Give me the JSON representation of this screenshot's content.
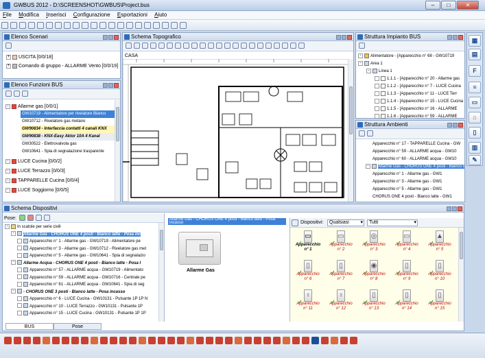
{
  "window": {
    "title": "GWBUS 2012 - D:\\SCREENSHOT\\GWBUS\\Project.bus",
    "min": "–",
    "max": "□",
    "close": "✕"
  },
  "menu": [
    {
      "accel": "F",
      "rest": "ile"
    },
    {
      "accel": "M",
      "rest": "odifica"
    },
    {
      "accel": "I",
      "rest": "nserisci"
    },
    {
      "accel": "C",
      "rest": "onfigurazione"
    },
    {
      "accel": "E",
      "rest": "sportazioni"
    },
    {
      "accel": "A",
      "rest": "iuto"
    }
  ],
  "scenari": {
    "title": "Elenco Scenari",
    "items": [
      {
        "label": "USCITA [0/0/18]"
      },
      {
        "label": "Comando di gruppo - ALLARME Vento [0/0/19]"
      }
    ]
  },
  "funzioni": {
    "title": "Elenco Funzioni BUS",
    "items": [
      {
        "label": "Allarme gas [0/0/1]",
        "kind": "group"
      },
      {
        "label": "GW10719 - Alimentatore per rivelatore Bianco",
        "kind": "sel"
      },
      {
        "label": "GW10712 - Rivelatore gas metano",
        "kind": "plain"
      },
      {
        "label": "GW90834 - Interfaccia contatti 4 canali KNX",
        "kind": "yel"
      },
      {
        "label": "GW90838 - KNX-Easy Aktor 10A 4 Kanal",
        "kind": "gry"
      },
      {
        "label": "GW30522 - Elettrovalvola gas",
        "kind": "plain"
      },
      {
        "label": "GW10641 - Spia di segnalazione trasparente",
        "kind": "plain"
      },
      {
        "label": "LUCE Cucina [0/0/2]",
        "kind": "group"
      },
      {
        "label": "LUCE Terrazzo [0/0/3]",
        "kind": "group"
      },
      {
        "label": "TAPPARELLE Cucina [0/0/4]",
        "kind": "group"
      },
      {
        "label": "LUCE Soggiorno [0/0/5]",
        "kind": "group"
      }
    ]
  },
  "topo": {
    "title": "Schema Topografico",
    "floor": "CASA"
  },
  "impianto": {
    "title": "Struttura Impianto BUS",
    "items": [
      {
        "label": "Alimentatore - [Apparecchio n° 68 - GW10719",
        "lvl": 0
      },
      {
        "label": "Area 1",
        "lvl": 0
      },
      {
        "label": "Linea 1",
        "lvl": 1
      },
      {
        "label": "1.1.1 - [Apparecchio n° 20 - Allarme gas",
        "lvl": 2
      },
      {
        "label": "1.1.2 - [Apparecchio n° 7 - LUCE Cucina",
        "lvl": 2
      },
      {
        "label": "1.1.3 - [Apparecchio n° 11 - LUCE Terr",
        "lvl": 2
      },
      {
        "label": "1.1.4 - [Apparecchio n° 15 - LUCE Cucina",
        "lvl": 2
      },
      {
        "label": "1.1.5 - [Apparecchio n° 16 - ALLARME",
        "lvl": 2
      },
      {
        "label": "1.1.6 - [Apparecchio n° 59 - ALLARME",
        "lvl": 2
      }
    ]
  },
  "ambienti": {
    "title": "Struttura Ambienti",
    "items": [
      {
        "label": "Apparecchio n° 17 - TAPPARELLE Cucina - GW",
        "kind": "plain"
      },
      {
        "label": "Apparecchio n° 59 - ALLARME acqua - GW10",
        "kind": "plain"
      },
      {
        "label": "Apparecchio n° 60 - ALLARME acqua - GW10",
        "kind": "plain"
      },
      {
        "label": "Allarme Gas - CHORUS ONE 4 posti - Bianco latte - GW1",
        "kind": "sel"
      },
      {
        "label": "Apparecchio n° 1 - Allarme gas - GW1",
        "kind": "plain"
      },
      {
        "label": "Apparecchio n° 3 - Allarme gas - GW1",
        "kind": "plain"
      },
      {
        "label": "Apparecchio n° 5 - Allarme gas - GW1",
        "kind": "plain"
      },
      {
        "label": "CHORUS ONE 4 posti - Bianco latte - GW1",
        "kind": "plain"
      }
    ]
  },
  "dispositivi": {
    "title": "Schema Dispositivi"
  },
  "pose": {
    "label": "Pose:",
    "items": [
      {
        "label": "In scatole per serie civili",
        "kind": "plain",
        "lvl": 0
      },
      {
        "label": "Allarme Gas - CHORUS ONE 4 posti - Bianco latte - Posa inc",
        "kind": "sel",
        "lvl": 1
      },
      {
        "label": "Apparecchio n° 1 - Allarme gas - GW10719 - Alimentatore pe",
        "kind": "plain",
        "lvl": 2
      },
      {
        "label": "Apparecchio n° 3 - Allarme gas - GW10712 - Rivelatore gas met",
        "kind": "plain",
        "lvl": 2
      },
      {
        "label": "Apparecchio n° 5 - Allarme gas - GW10641 - Spia di segnalazio",
        "kind": "plain",
        "lvl": 2
      },
      {
        "label": "Allarme Acqua - CHORUS ONE 4 posti - Bianco latte - Posa I",
        "kind": "bi",
        "lvl": 1
      },
      {
        "label": "Apparecchio n° 57 - ALLARME acqua - GW10719 - Alimentato",
        "kind": "plain",
        "lvl": 2
      },
      {
        "label": "Apparecchio n° 59 - ALLARME acqua - GW10716 - Centrale pe",
        "kind": "plain",
        "lvl": 2
      },
      {
        "label": "Apparecchio n° 61 - ALLARME acqua - GW10641 - Spia di seg",
        "kind": "plain",
        "lvl": 2
      },
      {
        "label": "- CHORUS ONE 3 posti - Bianco latte - Posa incasso",
        "kind": "bi",
        "lvl": 1
      },
      {
        "label": "Apparecchio n° 6 - LUCE Cucina - GW10131 - Pulsante 1P 1P N",
        "kind": "plain",
        "lvl": 2
      },
      {
        "label": "Apparecchio n° 10 - LUCE Terrazzo - GW10131 - Pulsante 1P",
        "kind": "plain",
        "lvl": 2
      },
      {
        "label": "Apparecchio n° 15 - LUCE Cucina - GW10131 - Pulsante 1P 1P",
        "kind": "plain",
        "lvl": 2
      }
    ]
  },
  "preview": {
    "header": "Allarme Gas - CHORUS ONE 4 posti - Bianco latte - Posa incasso",
    "caption": "Allarme Gas"
  },
  "devgrid": {
    "label": "Dispositivi:",
    "filter1": "Qualsiasi",
    "filter2": "Tutti",
    "items": [
      "Apparecchio n° 1",
      "Apparecchio n° 2",
      "Apparecchio n° 3",
      "Apparecchio n° 4",
      "Apparecchio n° 5",
      "Apparecchio n° 6",
      "Apparecchio n° 7",
      "Apparecchio n° 8",
      "Apparecchio n° 9",
      "Apparecchio n° 10",
      "Apparecchio n° 11",
      "Apparecchio n° 12",
      "Apparecchio n° 13",
      "Apparecchio n° 14",
      "Apparecchio n° 15"
    ]
  },
  "tabs": {
    "bus": "BUS",
    "pose": "Pose"
  }
}
